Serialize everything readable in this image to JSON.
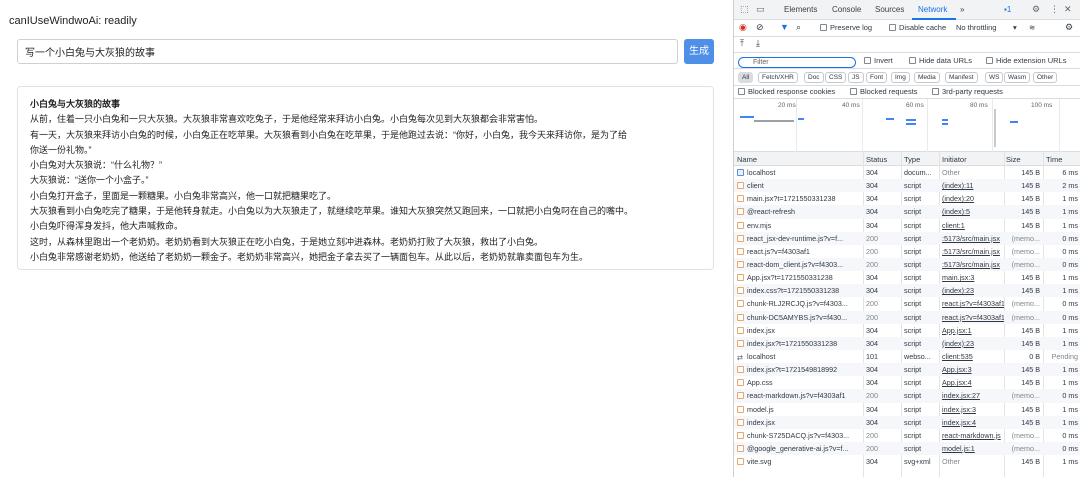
{
  "app": {
    "status": "canIUseWindwoAi: readily",
    "prompt_value": "写一个小白兔与大灰狼的故事",
    "generate_label": "生成",
    "story_title": "小白兔与大灰狼的故事",
    "story_lines": [
      "从前，住着一只小白兔和一只大灰狼。大灰狼非常喜欢吃兔子，于是他经常来拜访小白兔。小白兔每次见到大灰狼都会非常害怕。",
      "有一天，大灰狼来拜访小白兔的时候，小白兔正在吃苹果。大灰狼看到小白兔在吃苹果，于是他跑过去说：“你好，小白兔，我今天来拜访你，是为了给",
      "你送一份礼物。”",
      "小白兔对大灰狼说：“什么礼物？”",
      "大灰狼说：“送你一个小盒子。”",
      "小白兔打开盒子，里面是一颗糖果。小白兔非常高兴，他一口就把糖果吃了。",
      "大灰狼看到小白兔吃完了糖果，于是他转身就走。小白兔以为大灰狼走了，就继续吃苹果。谁知大灰狼突然又跑回来，一口就把小白兔叼在自己的嘴中。",
      "小白兔吓得浑身发抖，他大声喊救命。",
      "这时，从森林里跑出一个老奶奶。老奶奶看到大灰狼正在吃小白兔，于是她立刻冲进森林。老奶奶打败了大灰狼，救出了小白兔。",
      "小白兔非常感谢老奶奶，他送给了老奶奶一颗金子。老奶奶非常高兴，她把金子拿去买了一辆面包车。从此以后，老奶奶就靠卖面包车为生。"
    ]
  },
  "devtools": {
    "tabs": [
      "Elements",
      "Console",
      "Sources",
      "Network"
    ],
    "active_tab": "Network",
    "more_tabs": "»",
    "issues_count": "1",
    "toolbar": {
      "preserve_log": "Preserve log",
      "disable_cache": "Disable cache",
      "throttling": "No throttling"
    },
    "filter_placeholder": "Filter",
    "filter_options": {
      "invert": "Invert",
      "hide_data_urls": "Hide data URLs",
      "hide_extension_urls": "Hide extension URLs"
    },
    "type_chips": [
      "All",
      "Fetch/XHR",
      "Doc",
      "CSS",
      "JS",
      "Font",
      "Img",
      "Media",
      "Manifest",
      "WS",
      "Wasm",
      "Other"
    ],
    "blocked": {
      "blocked_cookies": "Blocked response cookies",
      "blocked_requests": "Blocked requests",
      "third_party": "3rd-party requests"
    },
    "timeline_ticks": [
      "20 ms",
      "40 ms",
      "60 ms",
      "80 ms",
      "100 ms"
    ],
    "columns": {
      "name": "Name",
      "status": "Status",
      "type": "Type",
      "initiator": "Initiator",
      "size": "Size",
      "time": "Time"
    },
    "requests": [
      {
        "name": "localhost",
        "status": "304",
        "type": "docum...",
        "initiator": "Other",
        "size": "145 B",
        "time": "6 ms",
        "kind": "doc"
      },
      {
        "name": "client",
        "status": "304",
        "type": "script",
        "initiator": "(index):11",
        "size": "145 B",
        "time": "2 ms",
        "kind": "js"
      },
      {
        "name": "main.jsx?t=1721550331238",
        "status": "304",
        "type": "script",
        "initiator": "(index):20",
        "size": "145 B",
        "time": "1 ms",
        "kind": "js"
      },
      {
        "name": "@react-refresh",
        "status": "304",
        "type": "script",
        "initiator": "(index):5",
        "size": "145 B",
        "time": "1 ms",
        "kind": "js"
      },
      {
        "name": "env.mjs",
        "status": "304",
        "type": "script",
        "initiator": "client:1",
        "size": "145 B",
        "time": "1 ms",
        "kind": "js"
      },
      {
        "name": "react_jsx-dev-runtime.js?v=f...",
        "status": "200",
        "type": "script",
        "initiator": ":5173/src/main.jsx",
        "size": "(memo...",
        "time": "0 ms",
        "kind": "js"
      },
      {
        "name": "react.js?v=f4303af1",
        "status": "200",
        "type": "script",
        "initiator": ":5173/src/main.jsx",
        "size": "(memo...",
        "time": "0 ms",
        "kind": "js"
      },
      {
        "name": "react-dom_client.js?v=f4303...",
        "status": "200",
        "type": "script",
        "initiator": ":5173/src/main.jsx",
        "size": "(memo...",
        "time": "0 ms",
        "kind": "js"
      },
      {
        "name": "App.jsx?t=1721550331238",
        "status": "304",
        "type": "script",
        "initiator": "main.jsx:3",
        "size": "145 B",
        "time": "1 ms",
        "kind": "js"
      },
      {
        "name": "index.css?t=1721550331238",
        "status": "304",
        "type": "script",
        "initiator": "(index):23",
        "size": "145 B",
        "time": "1 ms",
        "kind": "js"
      },
      {
        "name": "chunk-RLJ2RCJQ.js?v=f4303...",
        "status": "200",
        "type": "script",
        "initiator": "react.js?v=f4303af1",
        "size": "(memo...",
        "time": "0 ms",
        "kind": "js"
      },
      {
        "name": "chunk-DC5AMYBS.js?v=f430...",
        "status": "200",
        "type": "script",
        "initiator": "react.js?v=f4303af1",
        "size": "(memo...",
        "time": "0 ms",
        "kind": "js"
      },
      {
        "name": "index.jsx",
        "status": "304",
        "type": "script",
        "initiator": "App.jsx:1",
        "size": "145 B",
        "time": "1 ms",
        "kind": "js"
      },
      {
        "name": "index.jsx?t=1721550331238",
        "status": "304",
        "type": "script",
        "initiator": "(index):23",
        "size": "145 B",
        "time": "1 ms",
        "kind": "js"
      },
      {
        "name": "localhost",
        "status": "101",
        "type": "webso...",
        "initiator": "client:535",
        "size": "0 B",
        "time": "Pending",
        "kind": "ws"
      },
      {
        "name": "index.jsx?t=1721549818992",
        "status": "304",
        "type": "script",
        "initiator": "App.jsx:3",
        "size": "145 B",
        "time": "1 ms",
        "kind": "js"
      },
      {
        "name": "App.css",
        "status": "304",
        "type": "script",
        "initiator": "App.jsx:4",
        "size": "145 B",
        "time": "1 ms",
        "kind": "js"
      },
      {
        "name": "react-markdown.js?v=f4303af1",
        "status": "200",
        "type": "script",
        "initiator": "index.jsx:27",
        "size": "(memo...",
        "time": "0 ms",
        "kind": "js"
      },
      {
        "name": "model.js",
        "status": "304",
        "type": "script",
        "initiator": "index.jsx:3",
        "size": "145 B",
        "time": "1 ms",
        "kind": "js"
      },
      {
        "name": "index.jsx",
        "status": "304",
        "type": "script",
        "initiator": "index.jsx:4",
        "size": "145 B",
        "time": "1 ms",
        "kind": "js"
      },
      {
        "name": "chunk-S725DACQ.js?v=f4303...",
        "status": "200",
        "type": "script",
        "initiator": "react-markdown.js",
        "size": "(memo...",
        "time": "0 ms",
        "kind": "js"
      },
      {
        "name": "@google_generative-ai.js?v=f...",
        "status": "200",
        "type": "script",
        "initiator": "model.js:1",
        "size": "(memo...",
        "time": "0 ms",
        "kind": "js"
      },
      {
        "name": "vite.svg",
        "status": "304",
        "type": "svg+xml",
        "initiator": "Other",
        "size": "145 B",
        "time": "1 ms",
        "kind": "svg"
      }
    ]
  }
}
